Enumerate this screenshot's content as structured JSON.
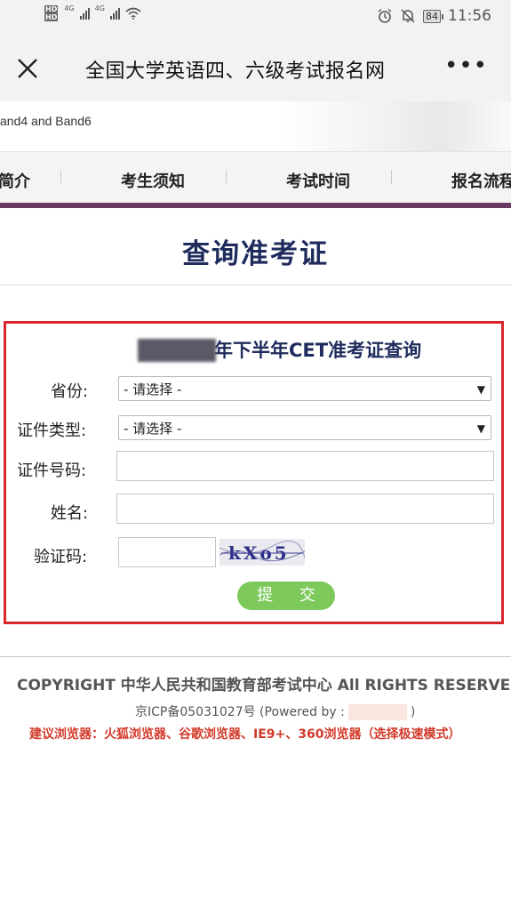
{
  "status_bar": {
    "hd1": "HD",
    "hd2": "HD",
    "net1": "4G",
    "net2": "4G",
    "battery": "84",
    "time": "11:56"
  },
  "title_bar": {
    "title": "全国大学英语四、六级考试报名网"
  },
  "banner": {
    "subtitle": "and4 and Band6"
  },
  "nav": {
    "items": [
      {
        "label": "简介"
      },
      {
        "label": "考生须知"
      },
      {
        "label": "考试时间"
      },
      {
        "label": "报名流程"
      }
    ]
  },
  "page": {
    "title": "查询准考证"
  },
  "form": {
    "title": "年下半年CET准考证查询",
    "province_label": "省份:",
    "province_value": "- 请选择 -",
    "id_type_label": "证件类型:",
    "id_type_value": "- 请选择 -",
    "id_number_label": "证件号码:",
    "name_label": "姓名:",
    "captcha_label": "验证码:",
    "captcha_text": "kXo5",
    "submit_label": "提 交"
  },
  "footer": {
    "copyright": "COPYRIGHT 中华人民共和国教育部考试中心 All RIGHTS RESERVED",
    "icp_prefix": "京ICP备05031027号 (Powered by :",
    "icp_suffix": ")",
    "browsers": "建议浏览器：火狐浏览器、谷歌浏览器、IE9+、360浏览器（选择极速模式）"
  },
  "colors": {
    "accent_nav_line": "#6b3a63",
    "title_blue": "#1e2b5c",
    "form_border": "#d9262c",
    "submit_green": "#7dc95c",
    "footer_red": "#d23a2a"
  }
}
